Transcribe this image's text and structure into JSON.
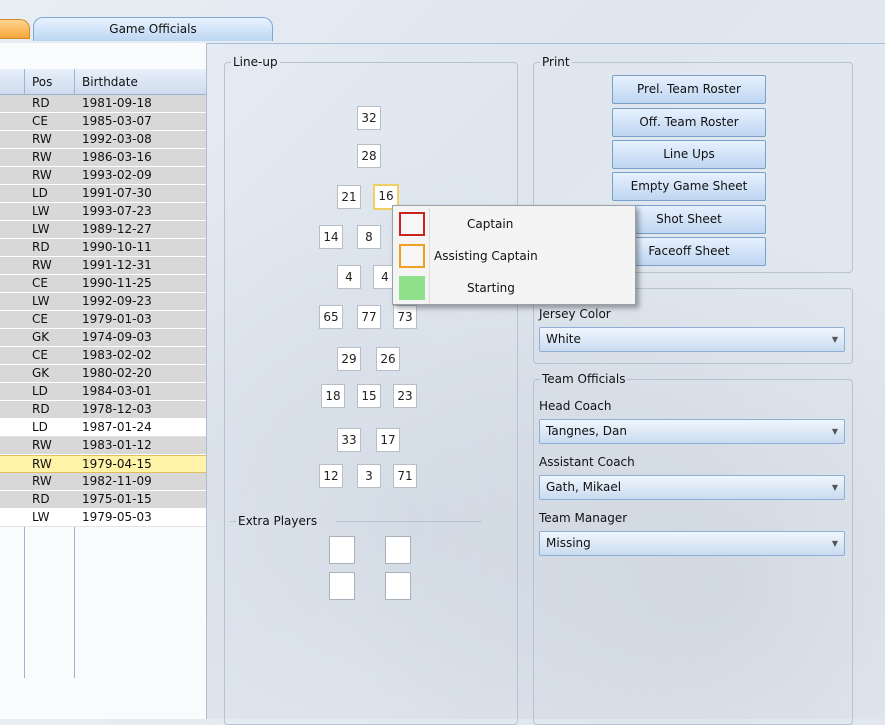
{
  "tabs": {
    "officials_label": "Game Officials"
  },
  "table": {
    "headers": {
      "pos": "Pos",
      "birthdate": "Birthdate"
    },
    "rows": [
      {
        "pos": "RD",
        "birthdate": "1981-09-18"
      },
      {
        "pos": "CE",
        "birthdate": "1985-03-07"
      },
      {
        "pos": "RW",
        "birthdate": "1992-03-08"
      },
      {
        "pos": "RW",
        "birthdate": "1986-03-16"
      },
      {
        "pos": "RW",
        "birthdate": "1993-02-09"
      },
      {
        "pos": "LD",
        "birthdate": "1991-07-30"
      },
      {
        "pos": "LW",
        "birthdate": "1993-07-23"
      },
      {
        "pos": "LW",
        "birthdate": "1989-12-27"
      },
      {
        "pos": "RD",
        "birthdate": "1990-10-11"
      },
      {
        "pos": "RW",
        "birthdate": "1991-12-31"
      },
      {
        "pos": "CE",
        "birthdate": "1990-11-25"
      },
      {
        "pos": "LW",
        "birthdate": "1992-09-23"
      },
      {
        "pos": "CE",
        "birthdate": "1979-01-03"
      },
      {
        "pos": "GK",
        "birthdate": "1974-09-03"
      },
      {
        "pos": "CE",
        "birthdate": "1983-02-02"
      },
      {
        "pos": "GK",
        "birthdate": "1980-02-20"
      },
      {
        "pos": "LD",
        "birthdate": "1984-03-01"
      },
      {
        "pos": "RD",
        "birthdate": "1978-12-03"
      },
      {
        "pos": "LD",
        "birthdate": "1987-01-24"
      },
      {
        "pos": "RW",
        "birthdate": "1983-01-12"
      },
      {
        "pos": "RW",
        "birthdate": "1979-04-15"
      },
      {
        "pos": "RW",
        "birthdate": "1982-11-09"
      },
      {
        "pos": "RD",
        "birthdate": "1975-01-15"
      },
      {
        "pos": "LW",
        "birthdate": "1979-05-03"
      }
    ]
  },
  "lineup": {
    "legend": "Line-up",
    "goalies": [
      "32",
      "28"
    ],
    "line1_forwards": [
      "21",
      "16"
    ],
    "line1_defense": [
      "14",
      "8"
    ],
    "line2_top": [
      "4",
      "4"
    ],
    "line2_bottom": [
      "65",
      "77",
      "73"
    ],
    "line3_top": [
      "29",
      "26"
    ],
    "line3_bottom": [
      "18",
      "15",
      "23"
    ],
    "line4_top": [
      "33",
      "17"
    ],
    "line4_bottom": [
      "12",
      "3",
      "71"
    ]
  },
  "extra_players": {
    "legend": "Extra Players"
  },
  "print": {
    "legend": "Print",
    "buttons": [
      "Prel. Team Roster",
      "Off. Team Roster",
      "Line Ups",
      "Empty Game Sheet",
      "Shot Sheet",
      "Faceoff Sheet"
    ]
  },
  "jersey": {
    "label": "Jersey Color",
    "value": "White"
  },
  "team_officials": {
    "legend": "Team Officials",
    "head_coach_label": "Head Coach",
    "head_coach_value": "Tangnes, Dan",
    "assistant_coach_label": "Assistant Coach",
    "assistant_coach_value": "Gath, Mikael",
    "team_manager_label": "Team Manager",
    "team_manager_value": "Missing"
  },
  "context_menu": {
    "items": [
      "Captain",
      "Assisting Captain",
      "Starting"
    ],
    "colors": {
      "captain": "#cc2222",
      "assisting": "#f0a020",
      "starting": "#8fe08a"
    }
  },
  "icons": {
    "combo_arrow": "chevron-down-icon"
  }
}
